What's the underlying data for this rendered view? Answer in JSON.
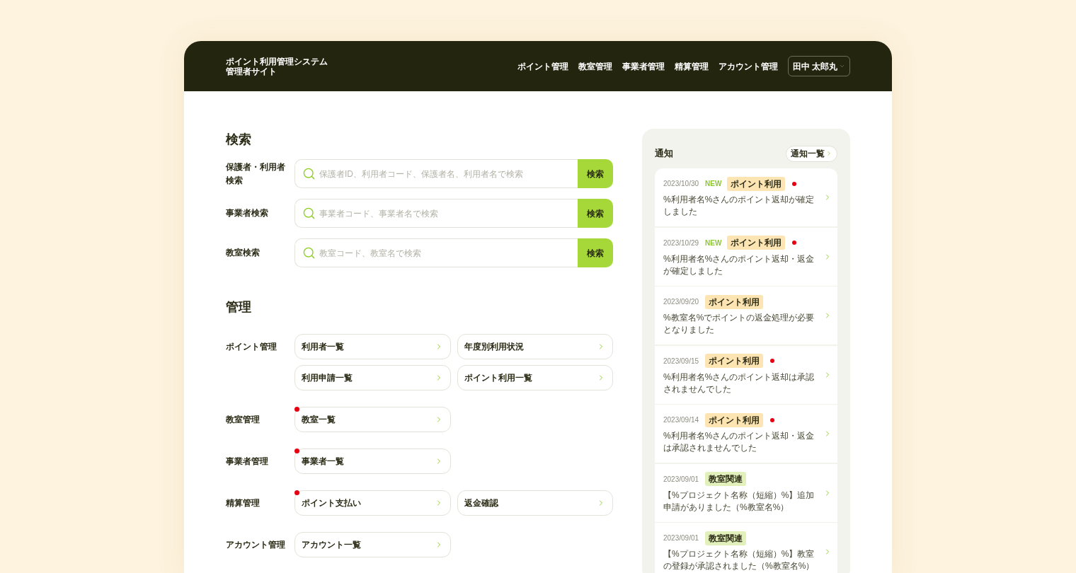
{
  "header": {
    "title_lines": [
      "ポイント利用管理システム",
      "管理者サイト"
    ],
    "nav": [
      "ポイント管理",
      "教室管理",
      "事業者管理",
      "精算管理",
      "アカウント管理"
    ],
    "user_menu": {
      "label": "田中 太郎丸"
    }
  },
  "search": {
    "heading": "検索",
    "rows": [
      {
        "label": "保護者・利用者検索",
        "placeholder": "保護者ID、利用者コード、保護者名、利用者名で検索",
        "button": "検索"
      },
      {
        "label": "事業者検索",
        "placeholder": "事業者コード、事業者名で検索",
        "button": "検索"
      },
      {
        "label": "教室検索",
        "placeholder": "教室コード、教室名で検索",
        "button": "検索"
      }
    ]
  },
  "management": {
    "heading": "管理",
    "groups": [
      {
        "label": "ポイント管理",
        "links": [
          {
            "label": "利用者一覧",
            "alert": false
          },
          {
            "label": "年度別利用状況",
            "alert": false
          },
          {
            "label": "利用申請一覧",
            "alert": false
          },
          {
            "label": "ポイント利用一覧",
            "alert": false
          }
        ]
      },
      {
        "label": "教室管理",
        "links": [
          {
            "label": "教室一覧",
            "alert": true
          }
        ]
      },
      {
        "label": "事業者管理",
        "links": [
          {
            "label": "事業者一覧",
            "alert": true
          }
        ]
      },
      {
        "label": "精算管理",
        "links": [
          {
            "label": "ポイント支払い",
            "alert": true
          },
          {
            "label": "返金確認",
            "alert": false
          }
        ]
      },
      {
        "label": "アカウント管理",
        "links": [
          {
            "label": "アカウント一覧",
            "alert": false
          }
        ]
      }
    ]
  },
  "notifications": {
    "heading": "通知",
    "view_all": "通知一覧",
    "items": [
      {
        "date": "2023/10/30",
        "badge": "NEW",
        "tag": {
          "label": "ポイント利用",
          "color": "#fde4b3"
        },
        "unread": true,
        "message": "%利用者名%さんのポイント返却が確定しました"
      },
      {
        "date": "2023/10/29",
        "badge": "NEW",
        "tag": {
          "label": "ポイント利用",
          "color": "#fde4b3"
        },
        "unread": true,
        "message": "%利用者名%さんのポイント返却・返金が確定しました"
      },
      {
        "date": "2023/09/20",
        "tag": {
          "label": "ポイント利用",
          "color": "#fde4b3"
        },
        "unread": false,
        "message": "%教室名%でポイントの返金処理が必要となりました"
      },
      {
        "date": "2023/09/15",
        "tag": {
          "label": "ポイント利用",
          "color": "#fde4b3"
        },
        "unread": true,
        "message": "%利用者名%さんのポイント返却は承認されませんでした"
      },
      {
        "date": "2023/09/14",
        "tag": {
          "label": "ポイント利用",
          "color": "#fde4b3"
        },
        "unread": true,
        "message": "%利用者名%さんのポイント返却・返金は承認されませんでした"
      },
      {
        "date": "2023/09/01",
        "tag": {
          "label": "教室関連",
          "color": "#e2f0bc"
        },
        "unread": false,
        "message": "【%プロジェクト名称（短縮）%】追加申請がありました（%教室名%）"
      },
      {
        "date": "2023/09/01",
        "tag": {
          "label": "教室関連",
          "color": "#e2f0bc"
        },
        "unread": false,
        "message": "【%プロジェクト名称（短縮）%】教室の登録が承認されました（%教室名%）"
      }
    ]
  }
}
